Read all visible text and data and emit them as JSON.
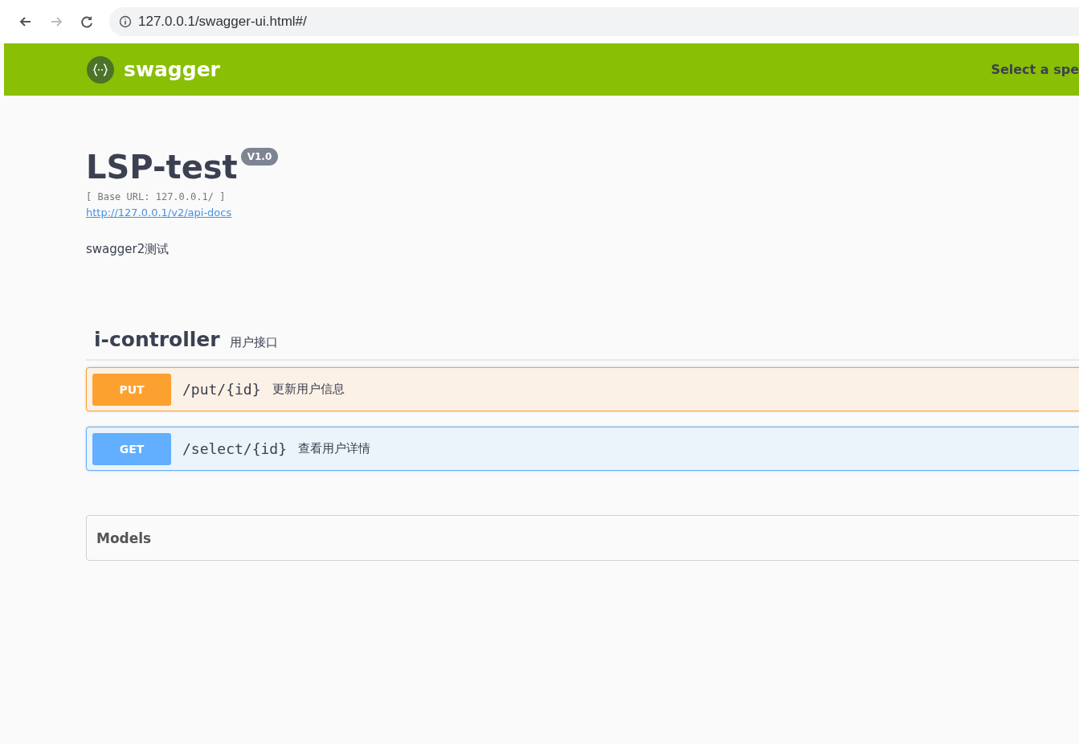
{
  "browser": {
    "url": "127.0.0.1/swagger-ui.html#/"
  },
  "topbar": {
    "logo": "swagger",
    "spec_label": "Select a spe"
  },
  "info": {
    "title": "LSP-test",
    "version": "V1.0",
    "base_url": "[ Base URL: 127.0.0.1/ ]",
    "docs_link": "http://127.0.0.1/v2/api-docs",
    "description": "swagger2测试"
  },
  "tag": {
    "name": "i-controller",
    "description": "用户接口"
  },
  "operations": [
    {
      "kind": "put",
      "method": "PUT",
      "path": "/put/{id}",
      "summary": "更新用户信息"
    },
    {
      "kind": "get",
      "method": "GET",
      "path": "/select/{id}",
      "summary": "查看用户详情"
    }
  ],
  "models": {
    "title": "Models"
  }
}
